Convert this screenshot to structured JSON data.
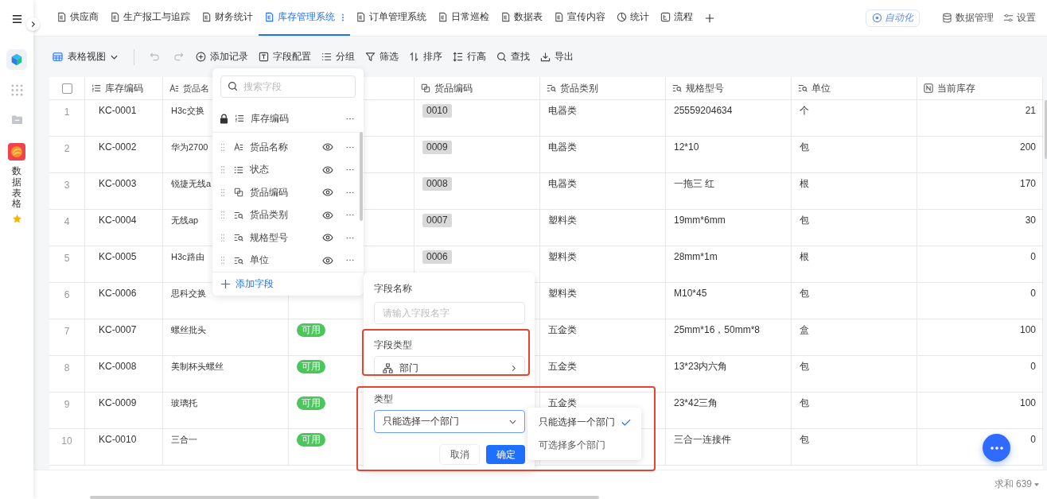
{
  "sidebar": {
    "app_label": "数据表格",
    "starred": true
  },
  "tabs": [
    {
      "label": "供应商",
      "kind": "form",
      "selected": false
    },
    {
      "label": "生产报工与追踪",
      "kind": "form",
      "selected": false
    },
    {
      "label": "财务统计",
      "kind": "form",
      "selected": false
    },
    {
      "label": "库存管理系统",
      "kind": "form",
      "selected": true
    },
    {
      "label": "订单管理系统",
      "kind": "form",
      "selected": false
    },
    {
      "label": "日常巡检",
      "kind": "form",
      "selected": false
    },
    {
      "label": "数据表",
      "kind": "form",
      "selected": false
    },
    {
      "label": "宣传内容",
      "kind": "form",
      "selected": false
    },
    {
      "label": "统计",
      "kind": "chart",
      "selected": false
    },
    {
      "label": "流程",
      "kind": "flow",
      "selected": false
    }
  ],
  "header_actions": [
    {
      "label": "自动化",
      "kind": "automation"
    },
    {
      "label": "数据管理",
      "kind": "database"
    },
    {
      "label": "设置",
      "kind": "settings"
    }
  ],
  "toolbar": {
    "view": "表格视图",
    "undo_disabled": true,
    "redo_disabled": true,
    "actions": [
      {
        "label": "添加记录",
        "kind": "add"
      },
      {
        "label": "字段配置",
        "kind": "field"
      },
      {
        "label": "分组",
        "kind": "group"
      },
      {
        "label": "筛选",
        "kind": "filter"
      },
      {
        "label": "排序",
        "kind": "sort"
      },
      {
        "label": "行高",
        "kind": "height"
      },
      {
        "label": "查找",
        "kind": "search"
      },
      {
        "label": "导出",
        "kind": "export"
      }
    ]
  },
  "table": {
    "all_selected": false,
    "columns": [
      {
        "label": "库存编码",
        "kind": "autonumber"
      },
      {
        "label": "货品名",
        "kind": "text"
      },
      {
        "label": "货品编码",
        "kind": "copy"
      },
      {
        "label": "货品类别",
        "kind": "lookup"
      },
      {
        "label": "规格型号",
        "kind": "lookup"
      },
      {
        "label": "单位",
        "kind": "lookup"
      },
      {
        "label": "当前库存",
        "kind": "number"
      }
    ],
    "rows": [
      {
        "index": "1",
        "code": "KC-0001",
        "name": "H3c交换",
        "item_code": "0010",
        "category": "电器类",
        "spec": "25559204634",
        "unit": "个",
        "stock": "21"
      },
      {
        "index": "2",
        "code": "KC-0002",
        "name": "华为2700",
        "item_code": "0009",
        "category": "电器类",
        "spec": "12*10",
        "unit": "包",
        "stock": "200"
      },
      {
        "index": "3",
        "code": "KC-0003",
        "name": "锐捷无线a",
        "item_code": "0008",
        "category": "电器类",
        "spec": "一拖三 红",
        "unit": "根",
        "stock": "170"
      },
      {
        "index": "4",
        "code": "KC-0004",
        "name": "无线ap",
        "item_code": "0007",
        "category": "塑料类",
        "spec": "19mm*6mm",
        "unit": "包",
        "stock": "30"
      },
      {
        "index": "5",
        "code": "KC-0005",
        "name": "H3c路由",
        "item_code": "0006",
        "category": "塑料类",
        "spec": "28mm*1m",
        "unit": "根",
        "stock": "0"
      },
      {
        "index": "6",
        "code": "KC-0006",
        "name": "思科交换",
        "category": "塑料类",
        "spec": "M10*45",
        "unit": "包",
        "stock": "0"
      },
      {
        "index": "7",
        "code": "KC-0007",
        "name": "螺丝批头",
        "status": "可用",
        "category": "五金类",
        "spec": "25mm*16，50mm*8",
        "unit": "盒",
        "stock": "100"
      },
      {
        "index": "8",
        "code": "KC-0008",
        "name": "美制杯头螺丝",
        "status": "可用",
        "category": "五金类",
        "spec": "13*23内六角",
        "unit": "包",
        "stock": "0"
      },
      {
        "index": "9",
        "code": "KC-0009",
        "name": "玻璃托",
        "status": "可用",
        "category": "五金类",
        "spec": "23*42三角",
        "unit": "包",
        "stock": "100"
      },
      {
        "index": "10",
        "code": "KC-0010",
        "name": "三合一",
        "status": "可用",
        "spec": "三合一连接件",
        "unit": "包",
        "stock": "0"
      }
    ]
  },
  "field_panel": {
    "search_placeholder": "搜索字段",
    "fields": [
      {
        "label": "库存编码",
        "kind": "autonumber",
        "locked": true
      },
      {
        "label": "货品名称",
        "kind": "text",
        "locked": false
      },
      {
        "label": "状态",
        "kind": "select",
        "locked": false
      },
      {
        "label": "货品编码",
        "kind": "copy",
        "locked": false
      },
      {
        "label": "货品类别",
        "kind": "lookup",
        "locked": false
      },
      {
        "label": "规格型号",
        "kind": "lookup",
        "locked": false
      },
      {
        "label": "单位",
        "kind": "lookup",
        "locked": false
      }
    ],
    "add_label": "添加字段"
  },
  "field_dialog": {
    "name_label": "字段名称",
    "name_placeholder": "请输入字段名字",
    "type_label": "字段类型",
    "type_value": "部门",
    "mode_label": "类型",
    "mode_value": "只能选择一个部门",
    "cancel": "取消",
    "confirm": "确定",
    "options": [
      {
        "label": "只能选择一个部门",
        "selected": true
      },
      {
        "label": "可选择多个部门",
        "selected": false
      }
    ]
  },
  "footer": {
    "sum": "求和 639"
  }
}
